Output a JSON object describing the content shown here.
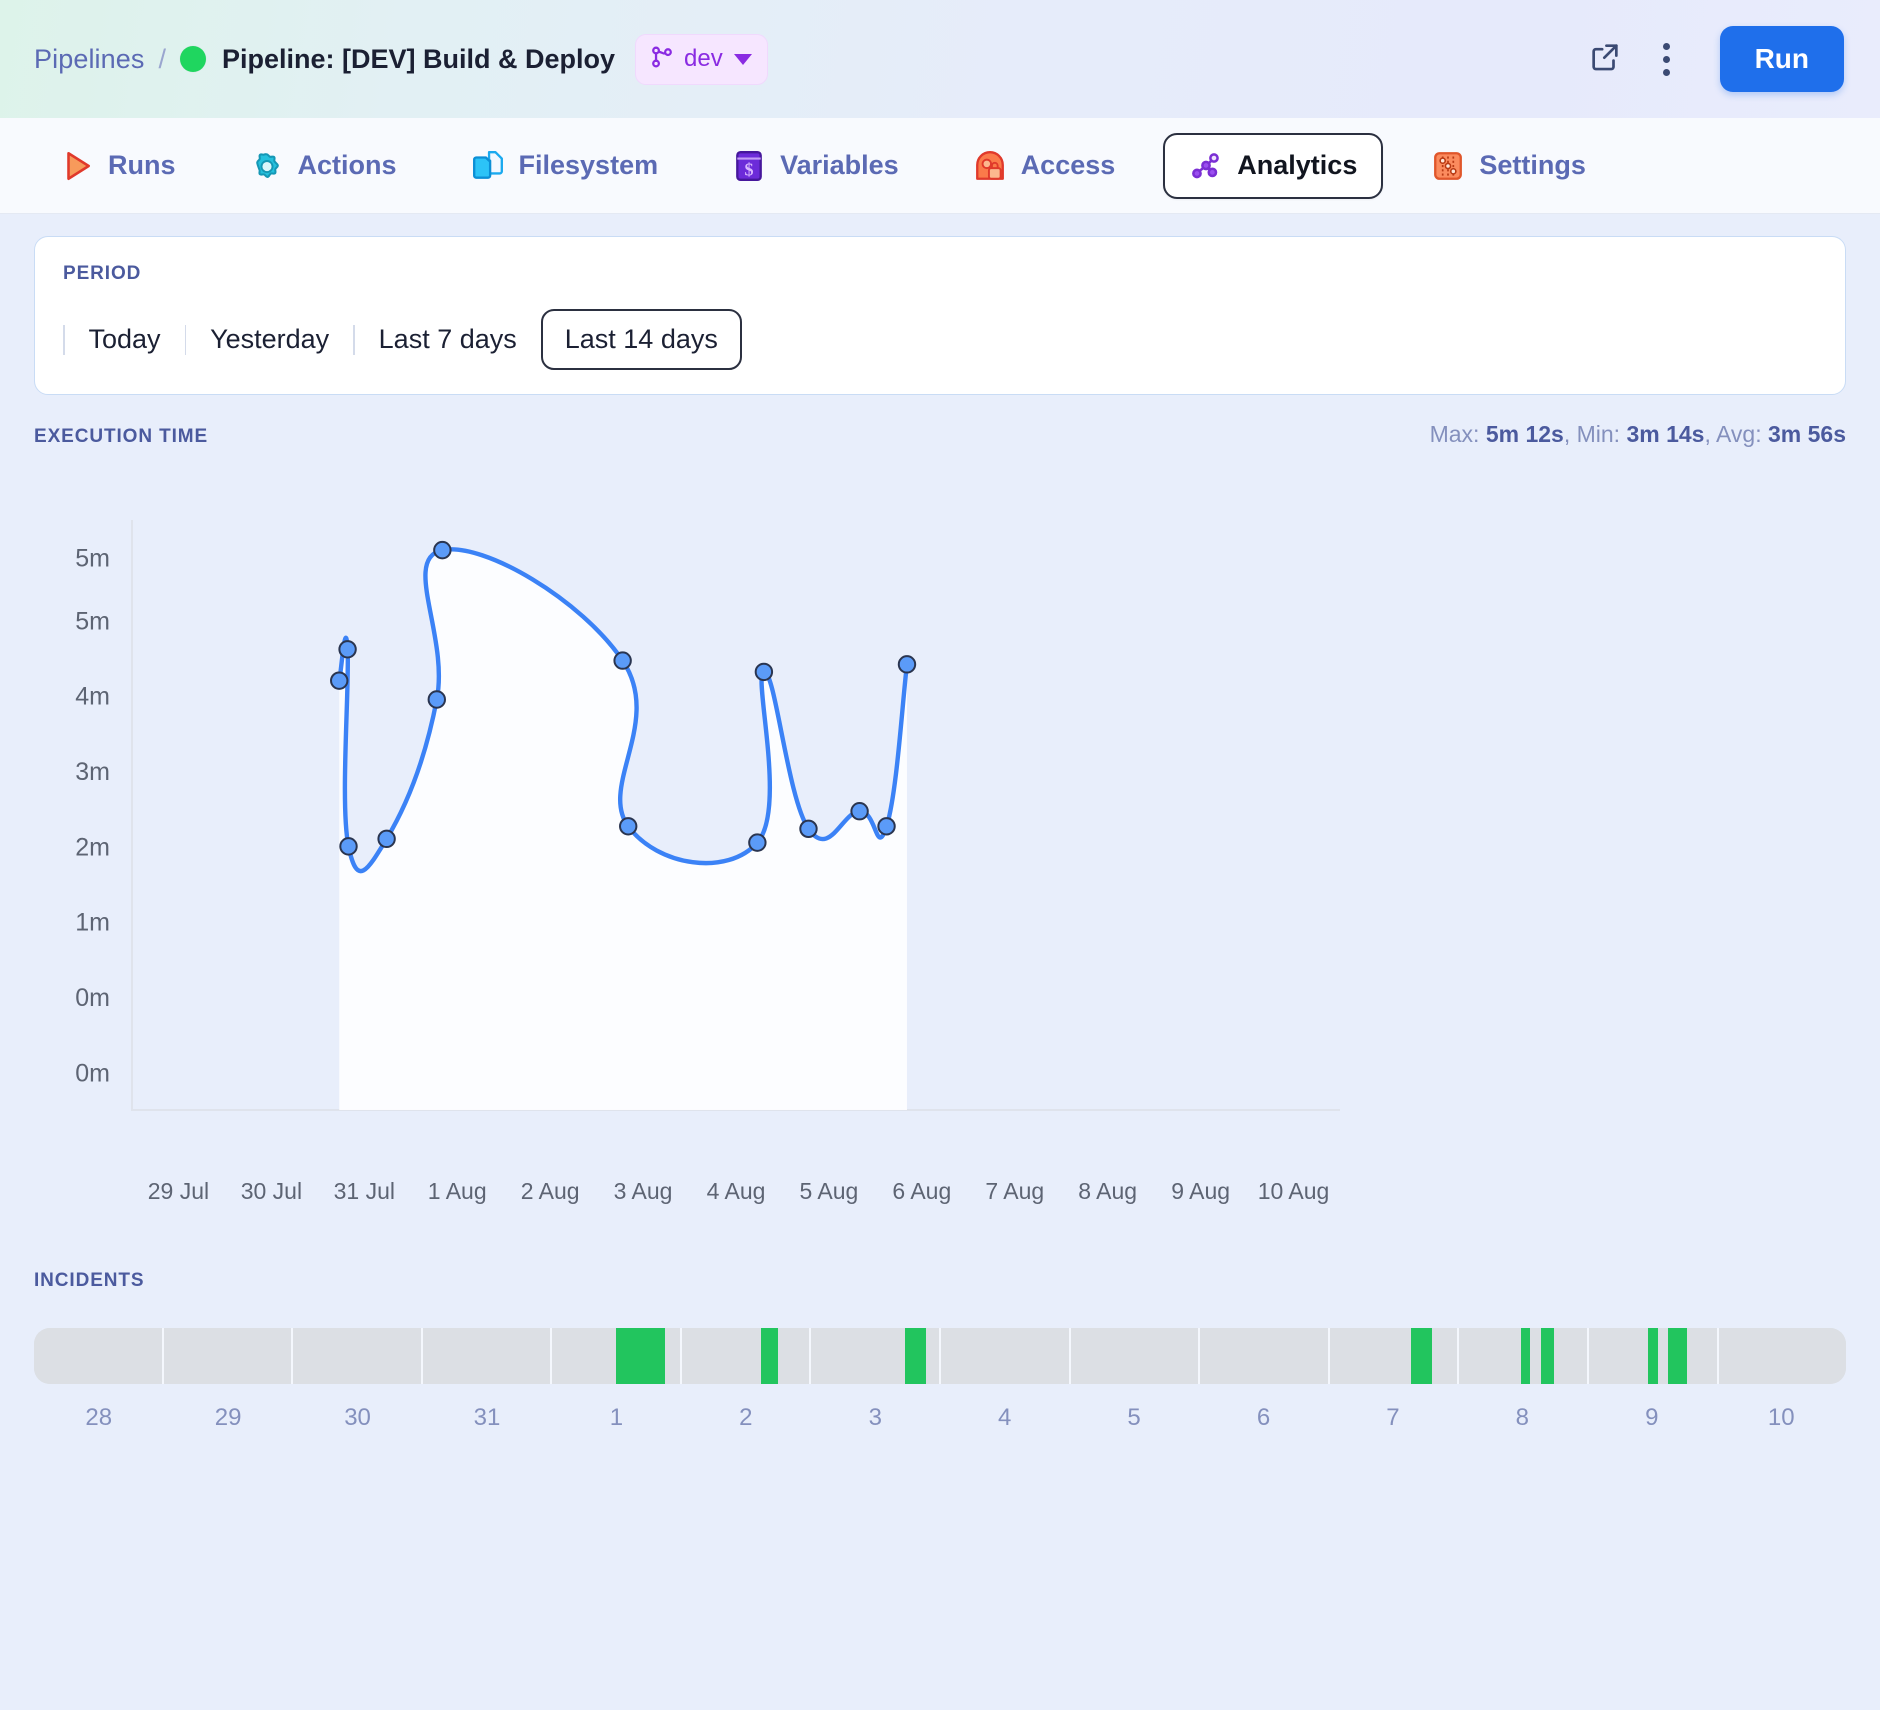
{
  "header": {
    "breadcrumb_root": "Pipelines",
    "breadcrumb_sep": "/",
    "title": "Pipeline: [DEV] Build & Deploy",
    "status_color": "#1fd65f",
    "branch": {
      "name": "dev",
      "icon": "branch-icon",
      "accent": "#8a2be2"
    },
    "external_link_icon": "external-link-icon",
    "more_icon": "kebab-menu-icon",
    "run_label": "Run",
    "run_color": "#1f6feb"
  },
  "tabs": [
    {
      "label": "Runs",
      "icon": "play-icon",
      "active": false
    },
    {
      "label": "Actions",
      "icon": "gear-icon",
      "active": false
    },
    {
      "label": "Filesystem",
      "icon": "folder-icon",
      "active": false
    },
    {
      "label": "Variables",
      "icon": "variable-icon",
      "active": false
    },
    {
      "label": "Access",
      "icon": "access-icon",
      "active": false
    },
    {
      "label": "Analytics",
      "icon": "analytics-icon",
      "active": true
    },
    {
      "label": "Settings",
      "icon": "sliders-icon",
      "active": false
    }
  ],
  "period": {
    "label": "PERIOD",
    "options": [
      "Today",
      "Yesterday",
      "Last 7 days",
      "Last 14 days"
    ],
    "selected": "Last 14 days"
  },
  "execution": {
    "title": "EXECUTION TIME",
    "max_label": "Max:",
    "max_value": "5m 12s",
    "min_label": "Min:",
    "min_value": "3m 14s",
    "avg_label": "Avg:",
    "avg_value": "3m 56s"
  },
  "incidents": {
    "title": "INCIDENTS",
    "days": [
      "28",
      "29",
      "30",
      "31",
      "1",
      "2",
      "3",
      "4",
      "5",
      "6",
      "7",
      "8",
      "9",
      "10"
    ],
    "marks": [
      {
        "day_index": 4,
        "offset_pct": 50,
        "width_pct": 38
      },
      {
        "day_index": 5,
        "offset_pct": 62,
        "width_pct": 13
      },
      {
        "day_index": 6,
        "offset_pct": 73,
        "width_pct": 17
      },
      {
        "day_index": 10,
        "offset_pct": 64,
        "width_pct": 16
      },
      {
        "day_index": 11,
        "offset_pct": 48,
        "width_pct": 7
      },
      {
        "day_index": 11,
        "offset_pct": 64,
        "width_pct": 10
      },
      {
        "day_index": 12,
        "offset_pct": 46,
        "width_pct": 8
      },
      {
        "day_index": 12,
        "offset_pct": 62,
        "width_pct": 15
      }
    ],
    "mark_color": "#22c55e",
    "track_color": "#dcdfe4"
  },
  "chart_data": {
    "type": "line",
    "title": "EXECUTION TIME",
    "xlabel": "",
    "ylabel": "",
    "grid": false,
    "legend": null,
    "line_color": "#3b82f6",
    "point_fill": "#5b9bf8",
    "point_stroke": "#2a3550",
    "area_fill": "#fdfdff",
    "ytick_labels": [
      "5m",
      "5m",
      "4m",
      "3m",
      "2m",
      "1m",
      "0m",
      "0m"
    ],
    "ytick_values": [
      5.2,
      4.7,
      4.1,
      3.5,
      2.9,
      2.3,
      1.7,
      1.1
    ],
    "ylim": [
      0.8,
      5.5
    ],
    "xtick_labels": [
      "29 Jul",
      "30 Jul",
      "31 Jul",
      "1 Aug",
      "2 Aug",
      "3 Aug",
      "4 Aug",
      "5 Aug",
      "6 Aug",
      "7 Aug",
      "8 Aug",
      "9 Aug",
      "10 Aug"
    ],
    "x": [
      2.23,
      2.32,
      2.33,
      2.74,
      3.28,
      3.34,
      5.28,
      5.34,
      6.73,
      6.8,
      7.28,
      7.83,
      8.12,
      8.34
    ],
    "values": [
      4.22,
      4.47,
      2.9,
      2.96,
      4.07,
      5.26,
      4.38,
      3.06,
      2.93,
      4.29,
      3.04,
      3.18,
      3.06,
      4.35
    ],
    "point_labels": [
      "4m 22s",
      "4m 47s",
      "2m 54s",
      "2m 58s",
      "4m 05s",
      "5m 12s",
      "4m 24s",
      "3m 06s",
      "3m 14s",
      "4m 18s",
      "3m 04s",
      "3m 12s",
      "3m 06s",
      "4m 22s"
    ]
  }
}
